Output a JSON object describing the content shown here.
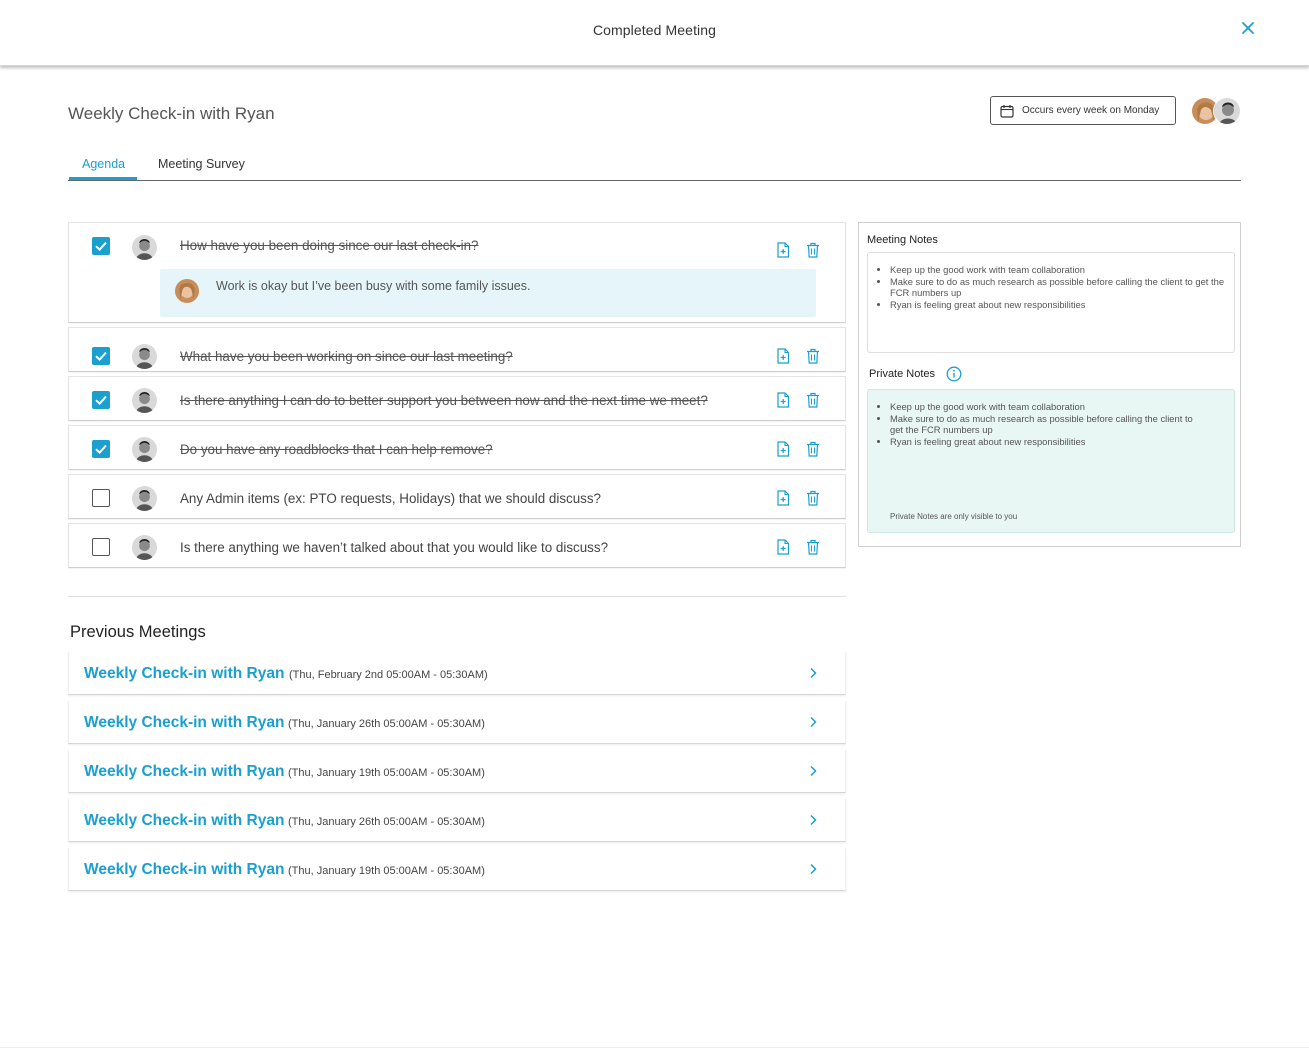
{
  "header": {
    "title": "Completed Meeting"
  },
  "meeting": {
    "title": "Weekly Check-in with Ryan",
    "recurrence": "Occurs every week on Monday"
  },
  "tabs": [
    {
      "label": "Agenda",
      "active": true
    },
    {
      "label": "Meeting Survey",
      "active": false
    }
  ],
  "agenda": [
    {
      "text": "How have you been doing since our last check-in?",
      "checked": true,
      "reply": "Work is okay but I’ve been busy with some family issues."
    },
    {
      "text": "What have you been working on since our last meeting?",
      "checked": true
    },
    {
      "text": "Is there anything I can do to better support you between now and the next time we meet?",
      "checked": true
    },
    {
      "text": "Do you have any roadblocks that I can help remove?",
      "checked": true
    },
    {
      "text": "Any Admin items (ex: PTO requests, Holidays) that we should discuss?",
      "checked": false
    },
    {
      "text": "Is there anything we haven’t talked about that you would like to discuss?",
      "checked": false
    }
  ],
  "previous": {
    "title": "Previous Meetings",
    "items": [
      {
        "name": "Weekly Check-in with Ryan",
        "time": "(Thu, February 2nd 05:00AM - 05:30AM)"
      },
      {
        "name": "Weekly Check-in with Ryan",
        "time": "(Thu, January 26th 05:00AM - 05:30AM)"
      },
      {
        "name": "Weekly Check-in with Ryan",
        "time": "(Thu, January 19th 05:00AM - 05:30AM)"
      },
      {
        "name": "Weekly Check-in with Ryan",
        "time": "(Thu, January 26th 05:00AM - 05:30AM)"
      },
      {
        "name": "Weekly Check-in with Ryan",
        "time": "(Thu, January 19th 05:00AM - 05:30AM)"
      }
    ]
  },
  "notes": {
    "meeting_label": "Meeting Notes",
    "meeting_items": [
      "Keep up the good work with team collaboration",
      "Make sure to do as much research as possible before calling the client to get the FCR numbers up",
      "Ryan is feeling great about new responsibilities"
    ],
    "private_label": "Private Notes",
    "private_items": [
      "Keep up the good work with team collaboration",
      "Make sure to do as much research as possible before calling the client to get the FCR numbers up",
      "Ryan is feeling great about new responsibilities"
    ],
    "private_hint": "Private Notes are only visible to you"
  },
  "colors": {
    "accent": "#1a9fcf",
    "reply_bg": "#e5f5fa",
    "private_bg": "#e8f7f4"
  },
  "icons": {
    "close": "close-icon",
    "calendar": "calendar-icon",
    "note": "add-note-icon",
    "delete": "trash-icon",
    "chevron": "chevron-right-icon",
    "info": "info-icon"
  }
}
